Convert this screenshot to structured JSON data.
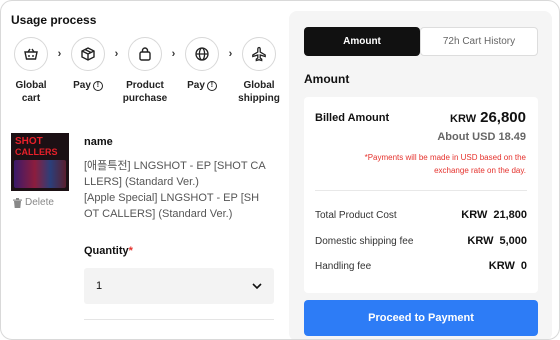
{
  "usage": {
    "title": "Usage process",
    "steps": [
      {
        "label": "Global cart",
        "icon": "basket-icon"
      },
      {
        "label": "Pay",
        "icon": "box-icon",
        "info": "!"
      },
      {
        "label": "Product purchase",
        "icon": "bag-icon"
      },
      {
        "label": "Pay",
        "icon": "globe-icon",
        "info": "!"
      },
      {
        "label": "Global shipping",
        "icon": "airplane-icon"
      }
    ]
  },
  "product": {
    "album_text_1": "SHOT",
    "album_text_2": "CALLERS",
    "delete_label": "Delete",
    "name_label": "name",
    "description": "[애플특전] LNGSHOT - EP [SHOT CALLERS] (Standard Ver.)\n[Apple Special] LNGSHOT - EP [SHOT CALLERS] (Standard Ver.)",
    "desc_line1": "[애플특전] LNGSHOT - EP [SHOT CA",
    "desc_line2": "LLERS] (Standard Ver.)",
    "desc_line3": "[Apple Special] LNGSHOT - EP [SH",
    "desc_line4": "OT CALLERS] (Standard Ver.)",
    "quantity_label": "Quantity",
    "required_mark": "*",
    "quantity_value": "1"
  },
  "tabs": [
    {
      "label": "Amount",
      "active": true
    },
    {
      "label": "72h Cart History",
      "active": false
    }
  ],
  "amount": {
    "title": "Amount",
    "billed_label": "Billed Amount",
    "billed_currency": "KRW",
    "billed_value": "26,800",
    "usd_label": "About USD 18.49",
    "note_line1": "*Payments will be made in USD based on the",
    "note_line2": "exchange rate on the day.",
    "rows": [
      {
        "label": "Total Product Cost",
        "currency": "KRW",
        "value": "21,800"
      },
      {
        "label": "Domestic shipping fee",
        "currency": "KRW",
        "value": "5,000"
      },
      {
        "label": "Handling fee",
        "currency": "KRW",
        "value": "0"
      }
    ]
  },
  "proceed_label": "Proceed to Payment",
  "colors": {
    "accent": "#2d7cf6",
    "required": "#e5322d",
    "active_tab": "#111111"
  }
}
